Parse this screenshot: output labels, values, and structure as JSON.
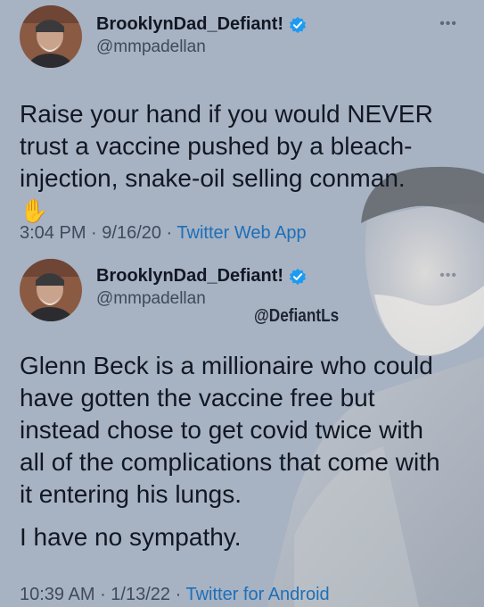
{
  "tweets": [
    {
      "display_name": "BrooklynDad_Defiant!",
      "handle": "@mmpadellan",
      "text": "Raise your hand if you would NEVER trust a vaccine pushed by a bleach-injection, snake-oil selling conman.",
      "emoji": "✋",
      "time": "3:04 PM",
      "date": "9/16/20",
      "app": "Twitter Web App"
    },
    {
      "display_name": "BrooklynDad_Defiant!",
      "handle": "@mmpadellan",
      "text_lines": [
        "Glenn Beck is a millionaire who could",
        "have gotten the vaccine free but",
        "instead chose to get covid twice with",
        "all of the complications that come with",
        "it entering his lungs."
      ],
      "text2": "I have no sympathy.",
      "time": "10:39 AM",
      "date": "1/13/22",
      "app": "Twitter for Android"
    }
  ],
  "watermark": "@DefiantLs",
  "more_icon": "more-dots-icon",
  "verified_icon": "verified-badge-icon",
  "colors": {
    "background": "#a7b2c3",
    "link": "#1d6fb8",
    "verified": "#1d9bf0"
  }
}
